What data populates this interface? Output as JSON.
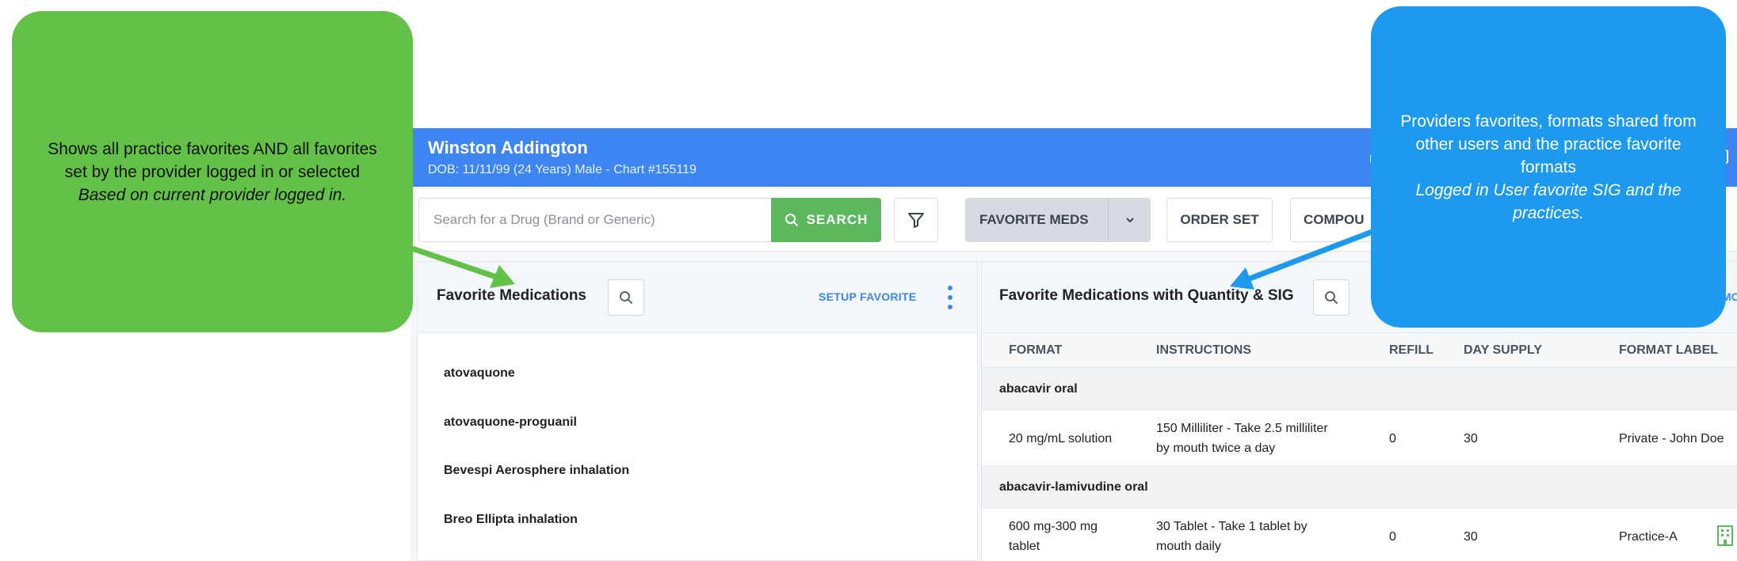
{
  "patient": {
    "name": "Winston Addington",
    "details": "DOB: 11/11/99 (24 Years) Male - Chart #155119"
  },
  "toolbar": {
    "search_placeholder": "Search for a Drug (Brand or Generic)",
    "search_label": "SEARCH",
    "favorite_meds_label": "FAVORITE MEDS",
    "order_set_label": "ORDER SET",
    "compound_label": "COMPOU"
  },
  "left_panel": {
    "title": "Favorite Medications",
    "setup_label": "SETUP FAVORITE",
    "items": [
      "atovaquone",
      "atovaquone-proguanil",
      "Bevespi Aerosphere inhalation",
      "Breo Ellipta inhalation"
    ]
  },
  "right_panel": {
    "title": "Favorite Medications with Quantity & SIG",
    "modify_label": "MODIF",
    "columns": [
      "FORMAT",
      "INSTRUCTIONS",
      "REFILL",
      "DAY SUPPLY",
      "FORMAT LABEL"
    ],
    "groups": [
      {
        "name": "abacavir oral",
        "rows": [
          {
            "format": "20 mg/mL solution",
            "instructions_1": "150 Milliliter - Take 2.5 milliliter",
            "instructions_2": "by mouth twice a day",
            "refill": "0",
            "day_supply": "30",
            "label": "Private - John Doe",
            "icon": null
          }
        ]
      },
      {
        "name": "abacavir-lamivudine oral",
        "rows": [
          {
            "format_1": "600 mg-300 mg",
            "format_2": "tablet",
            "instructions_1": "30 Tablet - Take 1 tablet by",
            "instructions_2": "mouth daily",
            "refill": "0",
            "day_supply": "30",
            "label": "Practice-A",
            "icon": "building-icon"
          }
        ]
      }
    ]
  },
  "callouts": {
    "green": {
      "text": "Shows all practice favorites  AND all favorites set by the provider logged in or selected",
      "italic": "Based on current provider logged in.",
      "color": "#62c146"
    },
    "blue": {
      "text": "Providers favorites, formats shared from other users and the practice favorite formats",
      "italic": "Logged in User favorite SIG and the practices.",
      "color": "#1d9aef"
    }
  },
  "colors": {
    "header": "#3d86f1",
    "search_button": "#5cb85c",
    "link": "#3d86f1"
  }
}
